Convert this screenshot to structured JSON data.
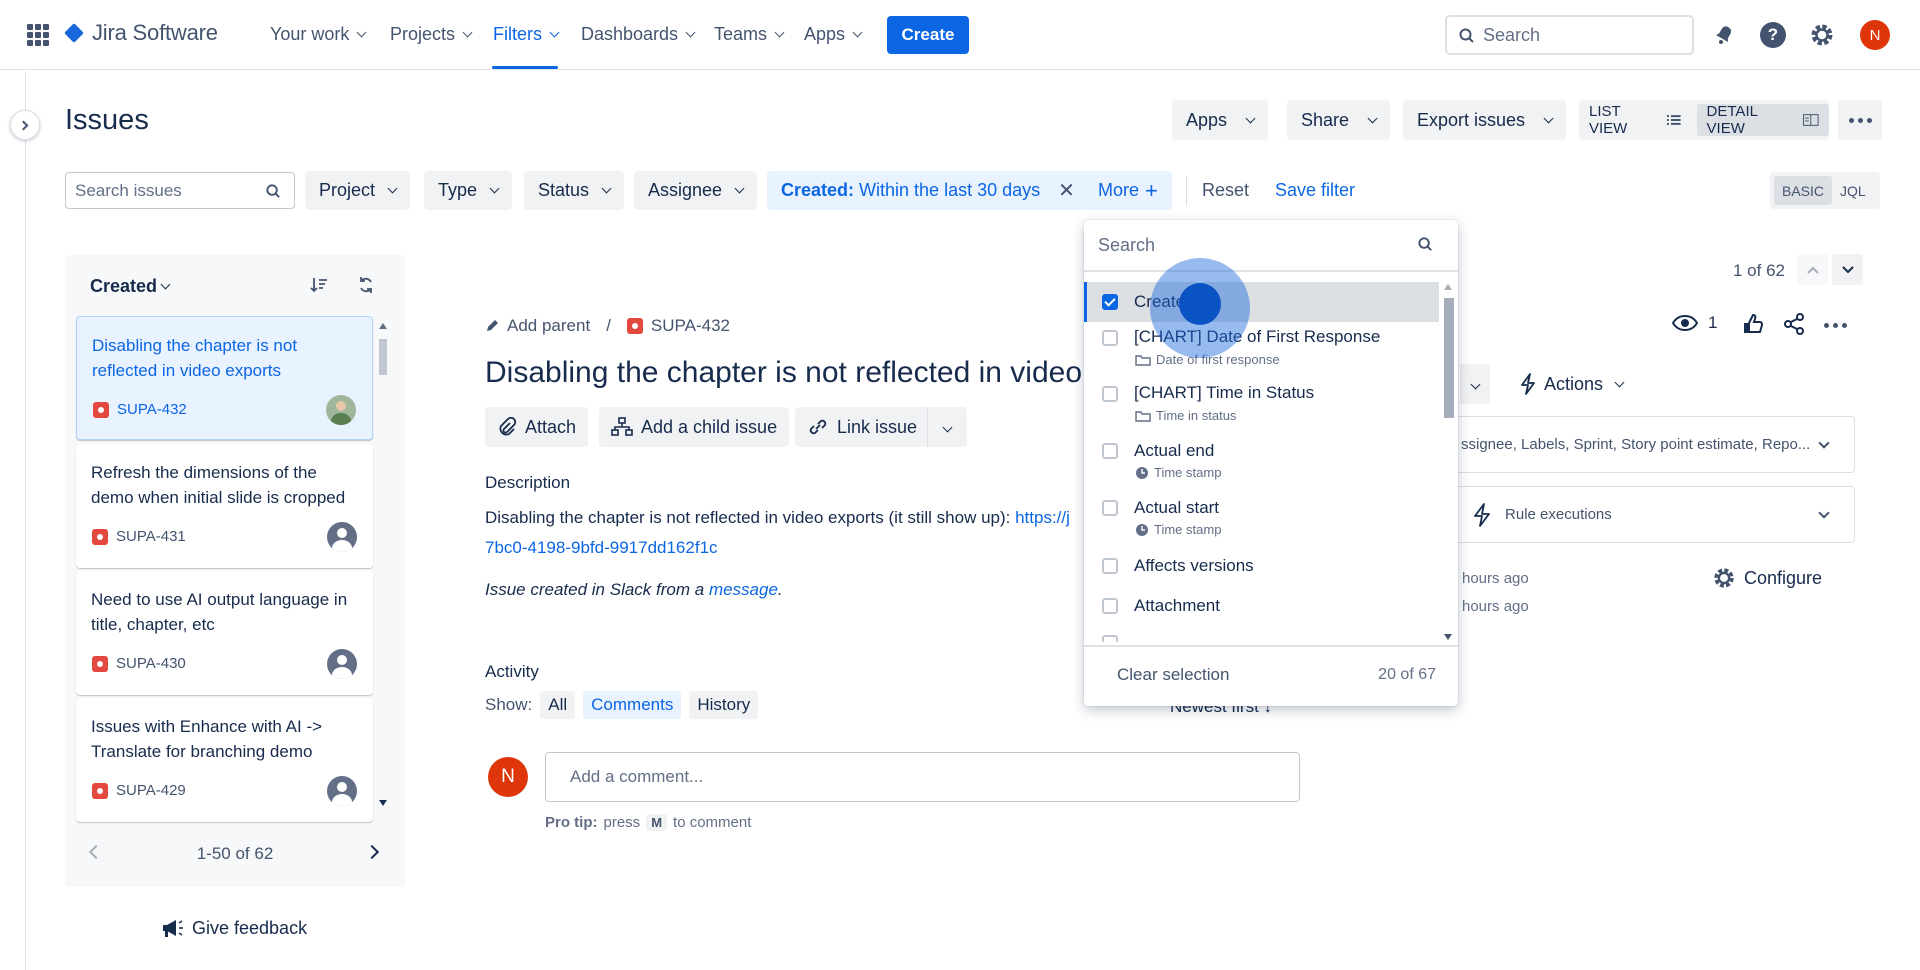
{
  "topnav": {
    "product": "Jira Software",
    "items": [
      {
        "label": "Your work"
      },
      {
        "label": "Projects"
      },
      {
        "label": "Filters"
      },
      {
        "label": "Dashboards"
      },
      {
        "label": "Teams"
      },
      {
        "label": "Apps"
      }
    ],
    "create_label": "Create",
    "search_placeholder": "Search",
    "avatar_initial": "N",
    "help_glyph": "?"
  },
  "header": {
    "title": "Issues",
    "apps_label": "Apps",
    "share_label": "Share",
    "export_label": "Export issues",
    "list_view_label": "LIST VIEW",
    "detail_view_label": "DETAIL VIEW"
  },
  "filters": {
    "search_placeholder": "Search issues",
    "project": "Project",
    "type": "Type",
    "status": "Status",
    "assignee": "Assignee",
    "created_key": "Created:",
    "created_value": "Within the last 30 days",
    "more": "More",
    "reset": "Reset",
    "save_filter": "Save filter",
    "basic": "BASIC",
    "jql": "JQL"
  },
  "issue_list": {
    "sort_label": "Created",
    "items": [
      {
        "title": "Disabling the chapter is not reflected in video exports",
        "key": "SUPA-432"
      },
      {
        "title": "Refresh the dimensions of the demo when initial slide is cropped",
        "key": "SUPA-431"
      },
      {
        "title": "Need to use AI output language in title, chapter, etc",
        "key": "SUPA-430"
      },
      {
        "title": "Issues with Enhance with AI -> Translate for branching demo",
        "key": "SUPA-429"
      }
    ],
    "pager": "1-50 of 62",
    "feedback": "Give feedback"
  },
  "issue": {
    "add_parent": "Add parent",
    "separator": "/",
    "key": "SUPA-432",
    "title": "Disabling the chapter is not reflected in video exports",
    "attach": "Attach",
    "add_child": "Add a child issue",
    "link_issue": "Link issue",
    "description_label": "Description",
    "description_text": "Disabling the chapter is not reflected in video exports (it still show up): ",
    "description_link1": "https://j",
    "description_link2": "7bc0-4198-9bfd-9917dd162f1c",
    "slack_note": "Issue created in Slack from a ",
    "slack_link": "message",
    "slack_end": ".",
    "activity_label": "Activity",
    "show_label": "Show:",
    "show_all": "All",
    "show_comments": "Comments",
    "show_history": "History",
    "newest_first": "Newest first",
    "comment_avatar": "N",
    "comment_placeholder": "Add a comment...",
    "protip_bold": "Pro tip:",
    "protip_press": "press",
    "protip_key": "M",
    "protip_end": "to comment"
  },
  "right_panel": {
    "counter": "1 of 62",
    "watch_count": "1",
    "actions": "Actions",
    "details_text": "ssignee, Labels, Sprint, Story point estimate, Repo...",
    "automation_label": "ion",
    "rule_executions": "Rule executions",
    "created_ago": "hours ago",
    "updated_ago": "hours ago",
    "configure": "Configure"
  },
  "dropdown": {
    "search_placeholder": "Search",
    "items": [
      {
        "label": "Created",
        "sub": "",
        "checked": true
      },
      {
        "label": "[CHART] Date of First Response",
        "sub": "Date of first response",
        "checked": false
      },
      {
        "label": "[CHART] Time in Status",
        "sub": "Time in status",
        "checked": false
      },
      {
        "label": "Actual end",
        "sub": "Time stamp",
        "checked": false
      },
      {
        "label": "Actual start",
        "sub": "Time stamp",
        "checked": false
      },
      {
        "label": "Affects versions",
        "sub": "",
        "checked": false
      },
      {
        "label": "Attachment",
        "sub": "",
        "checked": false
      }
    ],
    "clear_selection": "Clear selection",
    "count": "20 of 67"
  },
  "colors": {
    "brand_blue": "#0c66e4",
    "bug_red": "#e2483d",
    "avatar_red": "#de350b"
  }
}
